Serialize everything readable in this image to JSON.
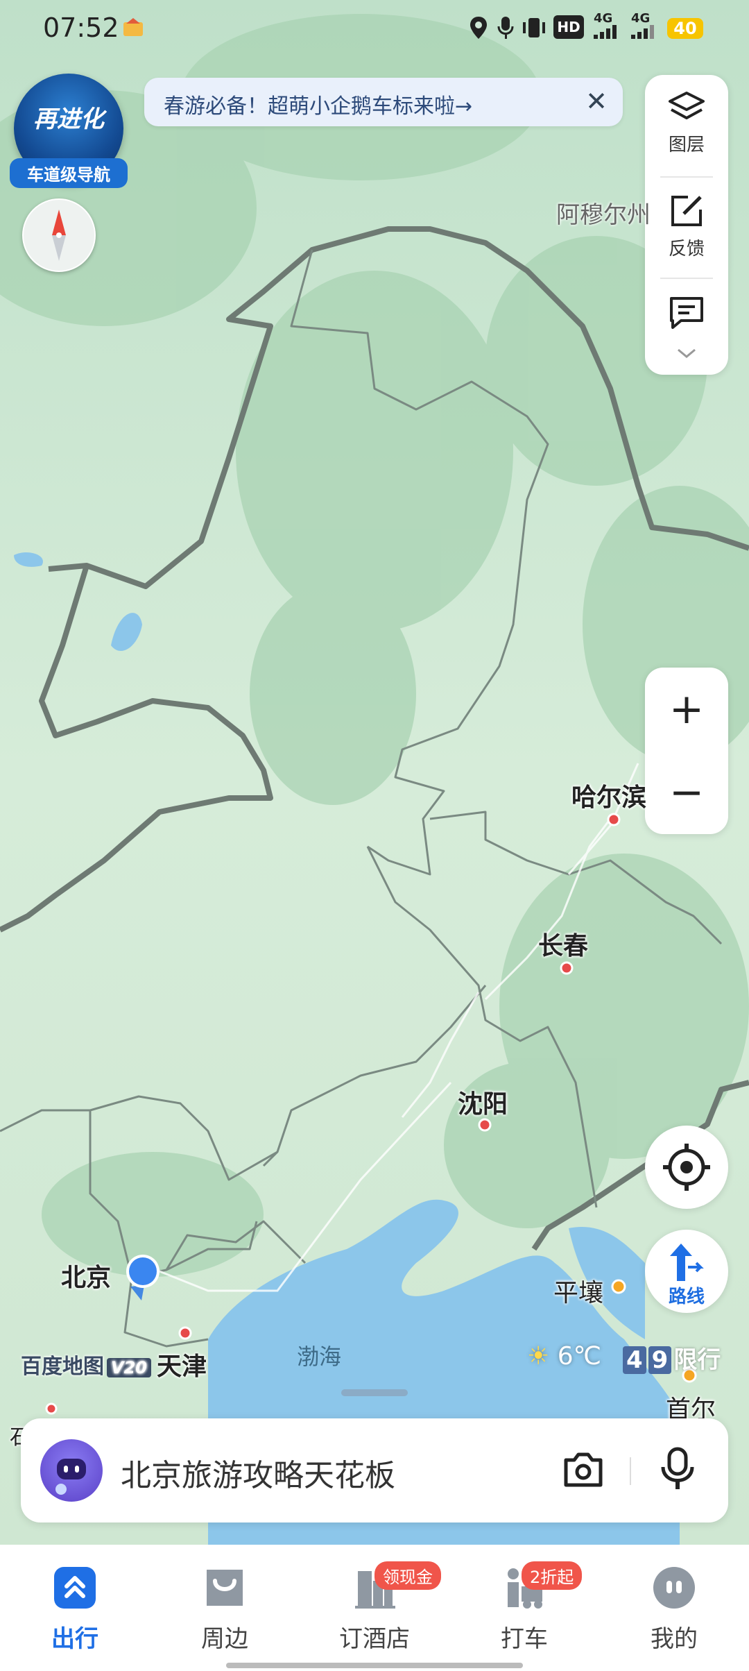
{
  "status_bar": {
    "time": "07:52",
    "network_1": "4G",
    "network_2": "4G",
    "hd": "HD",
    "battery": "40"
  },
  "upgrade_badge": {
    "title": "再进化",
    "subtitle": "车道级导航"
  },
  "banner": {
    "text": "春游必备！超萌小企鹅车标来啦→",
    "close": "✕"
  },
  "right_panel": {
    "layers": "图层",
    "feedback": "反馈"
  },
  "zoom": {
    "in": "+",
    "out": "−"
  },
  "route_button": {
    "label": "路线"
  },
  "map": {
    "cities": {
      "harbin": "哈尔滨",
      "changchun": "长春",
      "shenyang": "沈阳",
      "beijing": "北京",
      "tianjin": "天津",
      "pyongyang": "平壤",
      "seoul": "首尔"
    },
    "regions": {
      "amur": "阿穆尔州"
    },
    "sea": "渤海",
    "partial_label": "石"
  },
  "watermark": {
    "text": "百度地图",
    "badge": "V20"
  },
  "weather": {
    "temp": "6℃",
    "icon": "sun-icon"
  },
  "traffic_limit": {
    "num1": "4",
    "num2": "9",
    "label": "限行"
  },
  "search": {
    "placeholder": "北京旅游攻略天花板"
  },
  "bottom_nav": {
    "tabs": [
      {
        "label": "出行",
        "active": true
      },
      {
        "label": "周边"
      },
      {
        "label": "订酒店",
        "badge": "领现金"
      },
      {
        "label": "打车",
        "badge": "2折起"
      },
      {
        "label": "我的"
      }
    ]
  },
  "colors": {
    "accent": "#1f6fe5",
    "badge": "#f0554a",
    "sea": "#8cc6ea",
    "land": "#d9eedf"
  }
}
